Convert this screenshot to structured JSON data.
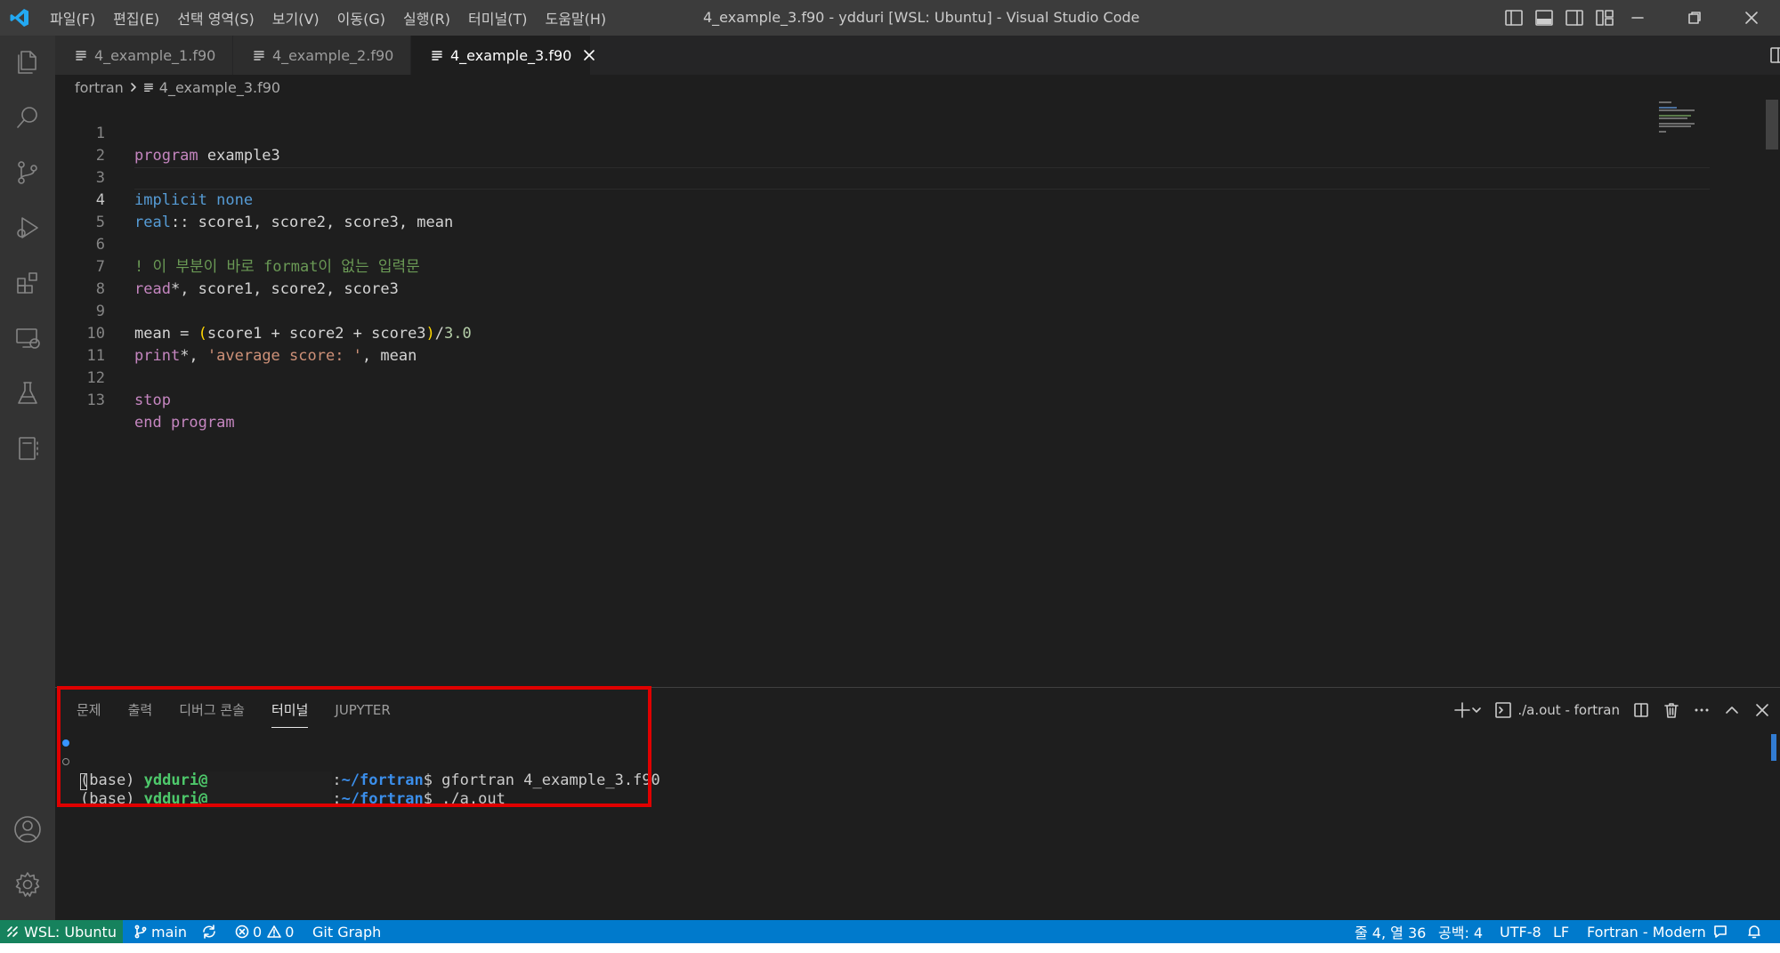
{
  "titlebar": {
    "menu": [
      "파일(F)",
      "편집(E)",
      "선택 영역(S)",
      "보기(V)",
      "이동(G)",
      "실행(R)",
      "터미널(T)",
      "도움말(H)"
    ],
    "window_title": "4_example_3.f90 - ydduri [WSL: Ubuntu] - Visual Studio Code"
  },
  "tabs": [
    {
      "label": "4_example_1.f90"
    },
    {
      "label": "4_example_2.f90"
    },
    {
      "label": "4_example_3.f90"
    }
  ],
  "breadcrumb": {
    "folder": "fortran",
    "file": "4_example_3.f90"
  },
  "editor": {
    "current_line": 4,
    "line_numbers": [
      "1",
      "2",
      "3",
      "4",
      "5",
      "6",
      "7",
      "8",
      "9",
      "10",
      "11",
      "12",
      "13"
    ],
    "tokens": {
      "l1_kw": "program",
      "l1_rest": " example3",
      "l3_kw": "implicit none",
      "l4_kw": "real",
      "l4_rest": ":: score1, score2, score3, mean",
      "l6_comment": "! 이 부분이 바로 format이 없는 입력문",
      "l7_kw": "read",
      "l7_rest": "*, score1, score2, score3",
      "l9_a": "mean = ",
      "l9_open": "(",
      "l9_mid": "score1 + score2 + score3",
      "l9_close": ")",
      "l9_div": "/",
      "l9_num": "3.0",
      "l10_kw": "print",
      "l10_a": "*, ",
      "l10_str": "'average score: '",
      "l10_b": ", mean",
      "l12_kw": "stop",
      "l13_kw": "end program"
    }
  },
  "panel": {
    "tabs": [
      "문제",
      "출력",
      "디버그 콘솔",
      "터미널",
      "JUPYTER"
    ],
    "active_tab": "터미널",
    "terminal_name": "./a.out - fortran",
    "terminal": {
      "lines": [
        {
          "prefix": "(base) ",
          "user": "ydduri@",
          "path_sep": ":",
          "path": "~/fortran",
          "cmd": "$ gfortran 4_example_3.f90"
        },
        {
          "prefix": "(base) ",
          "user": "ydduri@",
          "path_sep": ":",
          "path": "~/fortran",
          "cmd": "$ ./a.out"
        }
      ]
    }
  },
  "statusbar": {
    "remote": "WSL: Ubuntu",
    "branch": "main",
    "errors": "0",
    "warnings": "0",
    "git_graph": "Git Graph",
    "position": "줄 4, 열 36",
    "spaces": "공백: 4",
    "encoding": "UTF-8",
    "eol": "LF",
    "language": "Fortran - Modern"
  },
  "colors": {
    "accent": "#007acc",
    "remote": "#16825d",
    "highlight_box": "#e00000"
  }
}
